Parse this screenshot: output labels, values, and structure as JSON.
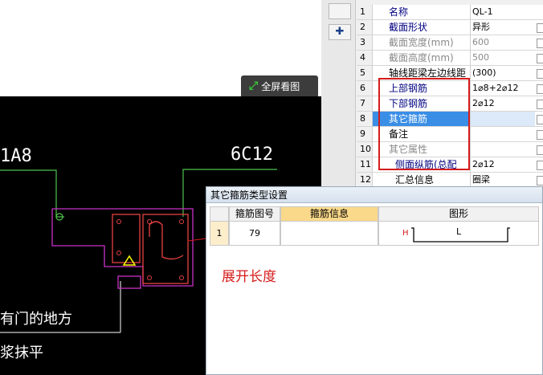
{
  "canvas_toolbar": {
    "fullscreen_label": "全屏看图"
  },
  "cad": {
    "labels": {
      "left_rebar": "1A8",
      "right_rebar": "6C12",
      "note_line1": "有门的地方",
      "note_line2": "浆抹平"
    },
    "colors": {
      "background": "#000000",
      "outline": "#c832c8",
      "rebar": "#e84040",
      "leader": "#4cc24c",
      "text": "#ffffff",
      "warning": "#ffff00"
    }
  },
  "properties": {
    "rows": [
      {
        "num": "1",
        "name": "名称",
        "value": "QL-1"
      },
      {
        "num": "2",
        "name": "截面形状",
        "value": "异形"
      },
      {
        "num": "3",
        "name": "截面宽度(mm)",
        "value": "600"
      },
      {
        "num": "4",
        "name": "截面高度(mm)",
        "value": "500"
      },
      {
        "num": "5",
        "name": "轴线距梁左边线距",
        "value": "(300)"
      },
      {
        "num": "6",
        "name": "上部钢筋",
        "value": "1⌀8+2⌀12"
      },
      {
        "num": "7",
        "name": "下部钢筋",
        "value": "2⌀12"
      },
      {
        "num": "8",
        "name": "其它箍筋",
        "value": ""
      },
      {
        "num": "9",
        "name": "备注",
        "value": ""
      },
      {
        "num": "10",
        "name": "其它属性",
        "value": ""
      },
      {
        "num": "11",
        "name": "侧面纵筋(总配",
        "value": "2⌀12"
      },
      {
        "num": "12",
        "name": "汇总信息",
        "value": "圈梁"
      }
    ]
  },
  "dialog": {
    "title": "其它箍筋类型设置",
    "columns": {
      "shape_no": "箍筋图号",
      "info": "箍筋信息",
      "figure": "图形"
    },
    "rows": [
      {
        "row_num": "1",
        "shape_no": "79",
        "info": "",
        "figure_h": "H",
        "figure_l": "L"
      }
    ]
  },
  "annotation": {
    "expand_length": "展开长度"
  },
  "accent_colors": {
    "highlight_box": "#d61b1b",
    "selected_row": "#3a8ee6",
    "header_highlight": "#fbd98a"
  }
}
